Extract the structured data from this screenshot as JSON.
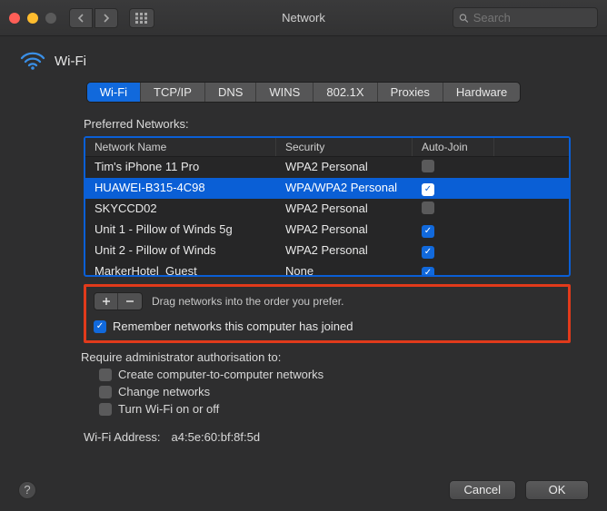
{
  "window": {
    "title": "Network",
    "search_placeholder": "Search"
  },
  "header": {
    "title": "Wi-Fi"
  },
  "tabs": [
    {
      "label": "Wi-Fi",
      "active": true
    },
    {
      "label": "TCP/IP"
    },
    {
      "label": "DNS"
    },
    {
      "label": "WINS"
    },
    {
      "label": "802.1X"
    },
    {
      "label": "Proxies"
    },
    {
      "label": "Hardware"
    }
  ],
  "preferred_label": "Preferred Networks:",
  "columns": {
    "name": "Network Name",
    "security": "Security",
    "autojoin": "Auto-Join"
  },
  "networks": [
    {
      "name": "Tim's iPhone 11 Pro",
      "security": "WPA2 Personal",
      "auto": false,
      "selected": false
    },
    {
      "name": "HUAWEI-B315-4C98",
      "security": "WPA/WPA2 Personal",
      "auto": true,
      "selected": true
    },
    {
      "name": "SKYCCD02",
      "security": "WPA2 Personal",
      "auto": false,
      "selected": false
    },
    {
      "name": "Unit 1 - Pillow of Winds 5g",
      "security": "WPA2 Personal",
      "auto": true,
      "selected": false
    },
    {
      "name": "Unit 2 - Pillow of Winds",
      "security": "WPA2 Personal",
      "auto": true,
      "selected": false
    },
    {
      "name": "MarkerHotel_Guest",
      "security": "None",
      "auto": true,
      "selected": false
    }
  ],
  "drag_hint": "Drag networks into the order you prefer.",
  "remember_label": "Remember networks this computer has joined",
  "remember_checked": true,
  "admin": {
    "heading": "Require administrator authorisation to:",
    "items": [
      {
        "label": "Create computer-to-computer networks",
        "checked": false
      },
      {
        "label": "Change networks",
        "checked": false
      },
      {
        "label": "Turn Wi-Fi on or off",
        "checked": false
      }
    ]
  },
  "wifi_address_label": "Wi-Fi Address:",
  "wifi_address_value": "a4:5e:60:bf:8f:5d",
  "footer": {
    "cancel": "Cancel",
    "ok": "OK"
  }
}
